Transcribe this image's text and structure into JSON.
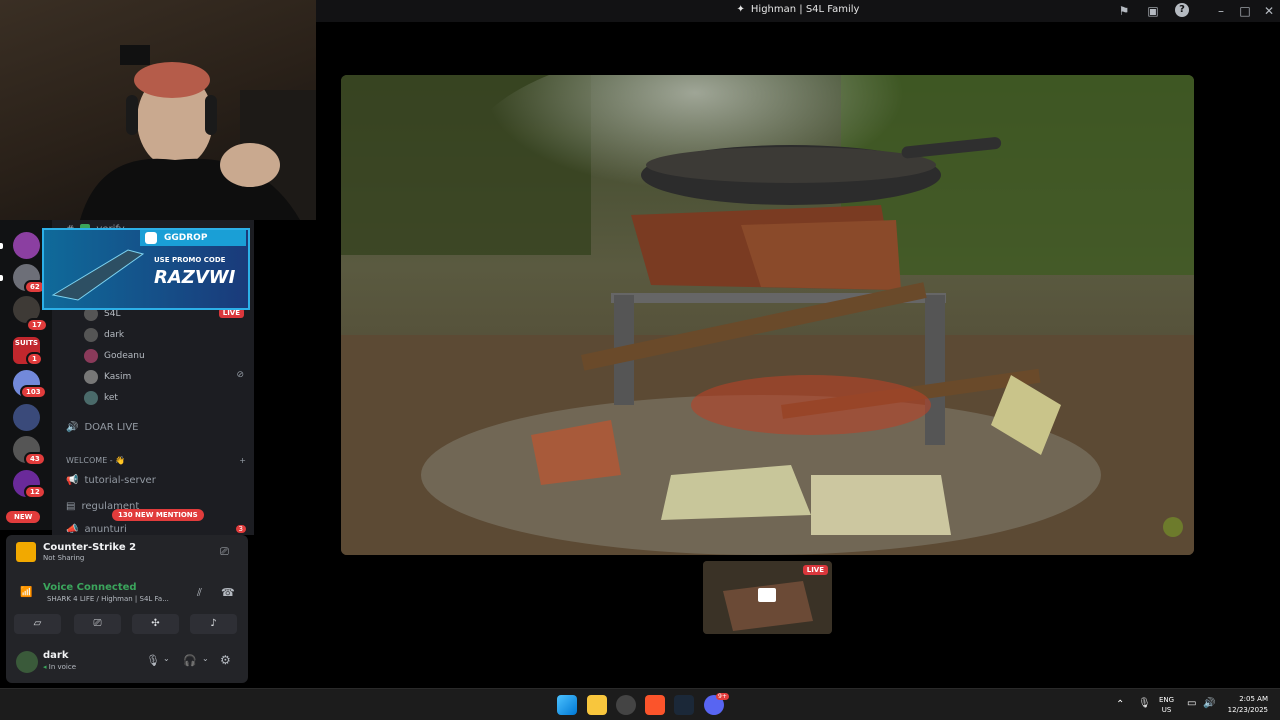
{
  "window": {
    "title": "Highman | S4L Family"
  },
  "stream": {
    "live_label": "LIVE"
  },
  "promo": {
    "brand": "GGDROP",
    "line1": "USE PROMO CODE",
    "code": "RAZVWI"
  },
  "servers": {
    "badges": [
      "62",
      "17",
      "1",
      "103",
      "43",
      "12"
    ],
    "new_label": "NEW",
    "suits_label": "SUITS"
  },
  "channels": {
    "verify": "verify",
    "streamer_name": "S4L",
    "live_badge": "LIVE",
    "members": [
      "dark",
      "Godeanu",
      "Kasim",
      "ket"
    ],
    "doar_live": "DOAR LIVE",
    "category_welcome": "WELCOME - 👋",
    "tutorial": "tutorial-server",
    "regulament": "regulament",
    "anunturi": "anunturi",
    "mentions_pill": "130 NEW MENTIONS",
    "anunturi_count": "3"
  },
  "activity": {
    "game": "Counter-Strike 2",
    "status": "Not Sharing"
  },
  "voice": {
    "status": "Voice Connected",
    "channel": "SHARK 4 LIFE / Highman | S4L Fa..."
  },
  "user": {
    "name": "dark",
    "status": "In voice"
  },
  "taskbar": {
    "lang_top": "ENG",
    "lang_bottom": "US",
    "time": "2:05 AM",
    "date": "12/23/2025",
    "discord_badge": "9+"
  }
}
